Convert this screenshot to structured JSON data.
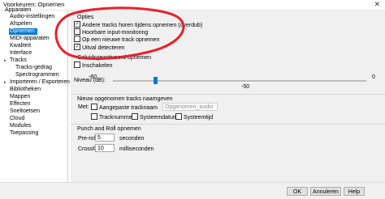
{
  "window": {
    "title": "Voorkeuren: Opnemen",
    "close_glyph": "✕"
  },
  "sidebar": {
    "items": [
      {
        "label": "Apparaten"
      },
      {
        "label": "Audio-instellingen"
      },
      {
        "label": "Afspelen"
      },
      {
        "label": "Opnemen",
        "selected": true
      },
      {
        "label": "MIDI-apparaten"
      },
      {
        "label": "Kwaliteit"
      },
      {
        "label": "Interface"
      },
      {
        "label": "Tracks"
      },
      {
        "label": "Tracks-gedrag"
      },
      {
        "label": "Spectrogrammen"
      },
      {
        "label": "Importeren / Exporteren"
      },
      {
        "label": "Bibliotheken"
      },
      {
        "label": "Mappen"
      },
      {
        "label": "Effecten"
      },
      {
        "label": "Sneltoetsen"
      },
      {
        "label": "Cloud"
      },
      {
        "label": "Modules"
      },
      {
        "label": "Toepassing"
      }
    ]
  },
  "options": {
    "group_title": "Opties",
    "checkboxes": [
      {
        "label": "Andere tracks horen tijdens opnemen (overdub)",
        "checked": true
      },
      {
        "label": "Hoorbare input-monitoring",
        "checked": false
      },
      {
        "label": "Op een nieuwe track opnemen",
        "checked": false
      },
      {
        "label": "Uitval detecteren",
        "checked": true
      }
    ]
  },
  "sound_activated": {
    "group_title": "Geluidsgeactiveerd opnemen",
    "checkbox_label": "Inschakelen",
    "level_label": "Niveau (dB):",
    "scale_min": "-60",
    "scale_max": "0",
    "value_label": "-50",
    "level_fraction": 0.167
  },
  "track_naming": {
    "group_title": "Nieuw opgenomen tracks naamgeven",
    "with_label": "Met:",
    "custom_name_label": "Aangepaste tracknaam",
    "custom_name_value": "Opgenomen_audio",
    "track_number_label": "Tracknummer",
    "system_date_label": "Systeemdatum",
    "system_time_label": "Systeemtijd"
  },
  "punch_roll": {
    "group_title": "Punch and Roll opnemen",
    "preroll_label": "Pre-roll:",
    "preroll_value": "5",
    "preroll_unit": "seconden",
    "crossfade_label": "Crossfaden:",
    "crossfade_value": "10",
    "crossfade_unit": "milliseconden"
  },
  "buttons": {
    "ok": "OK",
    "cancel": "Annuleren",
    "help": "Help"
  },
  "colors": {
    "selection": "#0078d7",
    "annotation": "#e8202a"
  }
}
